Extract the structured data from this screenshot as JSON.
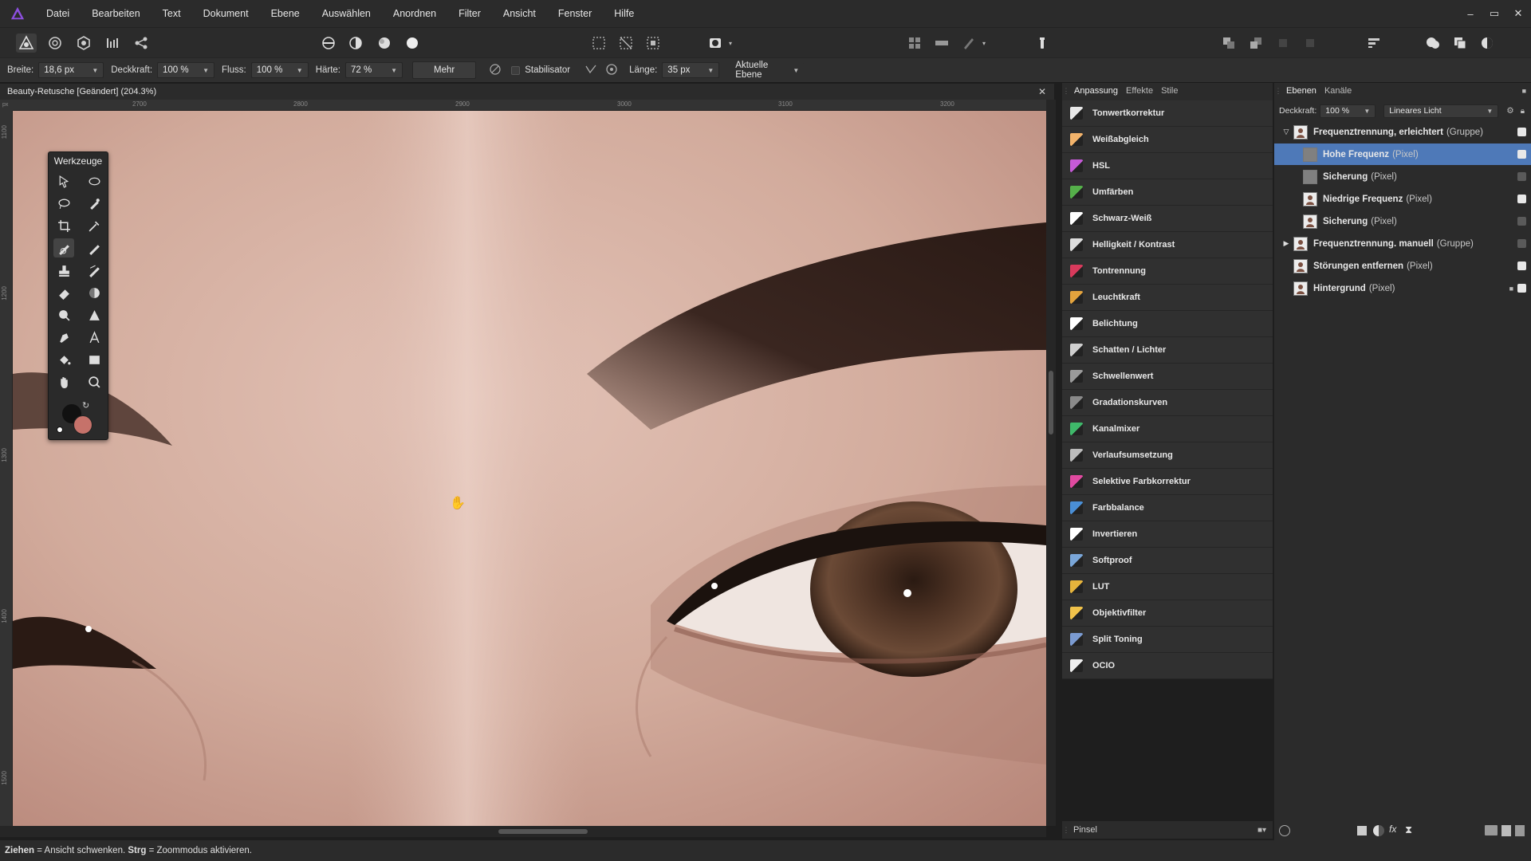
{
  "app": {
    "logo_icon": "affinity-photo-logo-icon"
  },
  "menu": [
    "Datei",
    "Bearbeiten",
    "Text",
    "Dokument",
    "Ebene",
    "Auswählen",
    "Anordnen",
    "Filter",
    "Ansicht",
    "Fenster",
    "Hilfe"
  ],
  "window_controls": [
    "–",
    "▭",
    "✕"
  ],
  "context": {
    "width_label": "Breite:",
    "width_value": "18,6 px",
    "opacity_label": "Deckkraft:",
    "opacity_value": "100 %",
    "flow_label": "Fluss:",
    "flow_value": "100 %",
    "hardness_label": "Härte:",
    "hardness_value": "72 %",
    "more_label": "Mehr",
    "stabilizer_label": "Stabilisator",
    "length_label": "Länge:",
    "length_value": "35 px",
    "target_value": "Aktuelle Ebene"
  },
  "document": {
    "tab_title": "Beauty-Retusche [Geändert] (204.3%)",
    "ruler_unit": "px",
    "ruler_top": [
      "2700",
      "2800",
      "2900",
      "3000",
      "3100",
      "3200"
    ],
    "ruler_left": [
      "1100",
      "1200",
      "1300",
      "1400",
      "1500",
      "1600",
      "1700"
    ]
  },
  "tools_panel": {
    "title": "Werkzeuge"
  },
  "adjustments": {
    "tabs": [
      "Anpassung",
      "Effekte",
      "Stile"
    ],
    "items": [
      {
        "label": "Tonwertkorrektur",
        "color": "#e8e8e8"
      },
      {
        "label": "Weißabgleich",
        "color": "#f2b36b"
      },
      {
        "label": "HSL",
        "color": "#c45ad6"
      },
      {
        "label": "Umfärben",
        "color": "#55b04a"
      },
      {
        "label": "Schwarz-Weiß",
        "color": "#ffffff"
      },
      {
        "label": "Helligkeit / Kontrast",
        "color": "#dddddd"
      },
      {
        "label": "Tontrennung",
        "color": "#d83a5c"
      },
      {
        "label": "Leuchtkraft",
        "color": "#e3a33d"
      },
      {
        "label": "Belichtung",
        "color": "#ffffff"
      },
      {
        "label": "Schatten / Lichter",
        "color": "#cfcfcf"
      },
      {
        "label": "Schwellenwert",
        "color": "#9a9a9a"
      },
      {
        "label": "Gradationskurven",
        "color": "#8a8a8a"
      },
      {
        "label": "Kanalmixer",
        "color": "#3fb86a"
      },
      {
        "label": "Verlaufsumsetzung",
        "color": "#bbbbbb"
      },
      {
        "label": "Selektive Farbkorrektur",
        "color": "#e04aa0"
      },
      {
        "label": "Farbbalance",
        "color": "#4a8fd6"
      },
      {
        "label": "Invertieren",
        "color": "#ffffff"
      },
      {
        "label": "Softproof",
        "color": "#7aa6d8"
      },
      {
        "label": "LUT",
        "color": "#e6b43c"
      },
      {
        "label": "Objektivfilter",
        "color": "#f0c24a"
      },
      {
        "label": "Split Toning",
        "color": "#7b9bd1"
      },
      {
        "label": "OCIO",
        "color": "#eeeeee"
      }
    ],
    "brush_label": "Pinsel"
  },
  "layers": {
    "tabs": [
      "Ebenen",
      "Kanäle"
    ],
    "opacity_label": "Deckkraft:",
    "opacity_value": "100 %",
    "blend_mode": "Lineares Licht",
    "rows": [
      {
        "name": "Frequenztrennung, erleichtert",
        "type": "(Gruppe)",
        "level": 0,
        "expanded": "open",
        "thumb": "portrait",
        "visible": true,
        "selected": false
      },
      {
        "name": "Hohe Frequenz",
        "type": "(Pixel)",
        "level": 1,
        "thumb": "gray",
        "visible": true,
        "selected": true
      },
      {
        "name": "Sicherung",
        "type": "(Pixel)",
        "level": 1,
        "thumb": "gray",
        "visible": false,
        "selected": false
      },
      {
        "name": "Niedrige Frequenz",
        "type": "(Pixel)",
        "level": 1,
        "thumb": "portrait",
        "visible": true,
        "selected": false
      },
      {
        "name": "Sicherung",
        "type": "(Pixel)",
        "level": 1,
        "thumb": "portrait",
        "visible": false,
        "selected": false
      },
      {
        "name": "Frequenztrennung. manuell",
        "type": "(Gruppe)",
        "level": 0,
        "expanded": "closed",
        "thumb": "portrait",
        "visible": false,
        "selected": false
      },
      {
        "name": "Störungen entfernen",
        "type": "(Pixel)",
        "level": 0,
        "thumb": "portrait",
        "visible": true,
        "selected": false
      },
      {
        "name": "Hintergrund",
        "type": "(Pixel)",
        "level": 0,
        "thumb": "portrait",
        "visible": true,
        "selected": false,
        "locked": true
      }
    ]
  },
  "status": {
    "key1": "Ziehen",
    "text1": " = Ansicht schwenken. ",
    "key2": "Strg",
    "text2": " = Zoommodus aktivieren."
  },
  "colors": {
    "accent": "#4b8fd6",
    "selected_row": "#4e79b8",
    "primary_color": "#111111",
    "secondary_color": "#c6726a"
  }
}
